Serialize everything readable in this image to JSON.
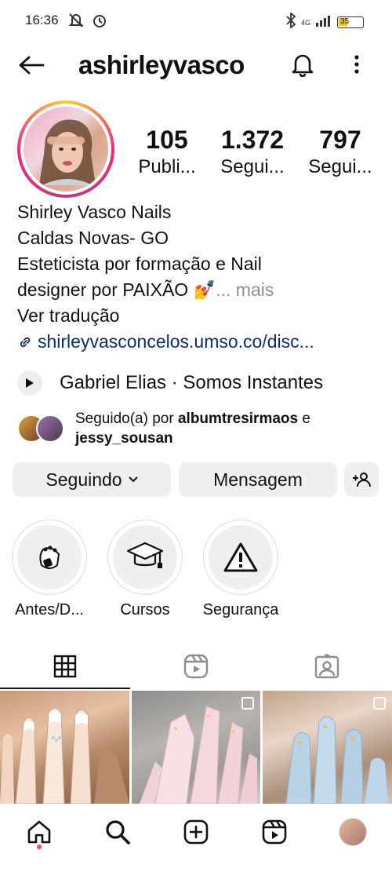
{
  "status_bar": {
    "time": "16:36",
    "battery": "35",
    "network": "4G"
  },
  "header": {
    "username": "ashirleyvasco"
  },
  "stats": [
    {
      "value": "105",
      "label": "Publi..."
    },
    {
      "value": "1.372",
      "label": "Segui..."
    },
    {
      "value": "797",
      "label": "Segui..."
    }
  ],
  "bio": {
    "name": "Shirley Vasco Nails",
    "location": "Caldas Novas- GO",
    "line1": "Esteticista por formação e Nail",
    "line2": "designer por PAIXÃO 💅",
    "more": "... mais",
    "translate": "Ver tradução",
    "link": "shirleyvasconcelos.umso.co/disc..."
  },
  "music": {
    "text": "Gabriel Elias · Somos Instantes"
  },
  "followed_by": {
    "prefix": "Seguido(a) por ",
    "user1": "albumtresirmaos",
    "joiner": " e",
    "user2": "jessy_sousan"
  },
  "actions": {
    "following": "Seguindo",
    "message": "Mensagem"
  },
  "highlights": [
    {
      "label": "Antes/D...",
      "icon": "nail-hand-icon"
    },
    {
      "label": "Cursos",
      "icon": "graduation-cap-icon"
    },
    {
      "label": "Segurança",
      "icon": "warning-icon"
    }
  ],
  "colors": {
    "button_bg": "#efefef",
    "link": "#0a3069",
    "notification_dot": "#ed4956",
    "muted": "#8e8e8e"
  }
}
